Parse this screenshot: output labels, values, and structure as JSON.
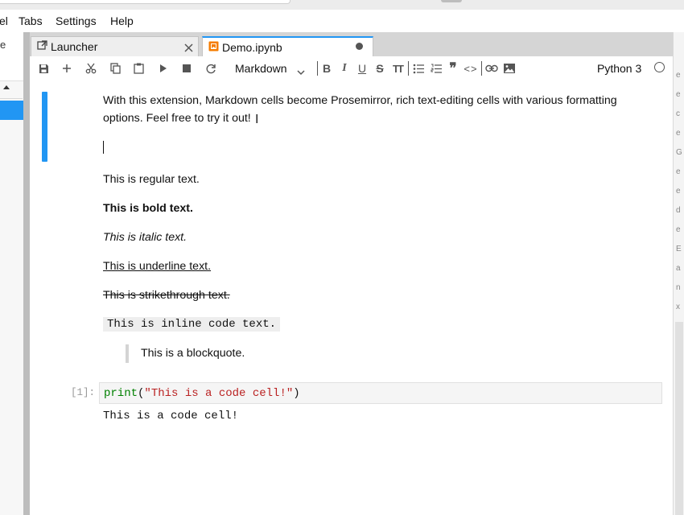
{
  "menubar": {
    "items": [
      "el",
      "Tabs",
      "Settings",
      "Help"
    ]
  },
  "sidebar": {
    "fragment": "e"
  },
  "tabs": [
    {
      "label": "Launcher",
      "icon": "launcher-icon",
      "action_icon": "close-icon"
    },
    {
      "label": "Demo.ipynb",
      "icon": "notebook-icon",
      "action_icon": "unsaved-dot-icon",
      "active": true
    }
  ],
  "toolbar": {
    "cell_type": "Markdown",
    "kernel_name": "Python 3",
    "format": {
      "bold": "B",
      "italic": "I",
      "underline": "U",
      "strike": "S",
      "text_size": "TT",
      "quote": "❞",
      "code": "<>"
    }
  },
  "notebook": {
    "intro_line1": "With this extension, Markdown cells become Prosemirror, rich text-editing cells with various formatting",
    "intro_line2": "options. Feel free to try it out!",
    "regular": "This is regular text.",
    "bold": "This is bold text.",
    "italic": "This is italic text.",
    "underline": "This is underline text.",
    "strikethrough": "This is strikethrough text.",
    "inline_code": "This is inline code text.",
    "blockquote": "This is a blockquote.",
    "code_cell": {
      "prompt": "[1]:",
      "fn": "print",
      "open": "(",
      "string": "\"This is a code cell!\"",
      "close": ")",
      "output": "This is a code cell!"
    }
  },
  "scroll_fragments": [
    "e",
    "e",
    "c",
    "e",
    "G",
    "e",
    "e",
    "d",
    "e",
    "E",
    "a",
    "n",
    "x"
  ],
  "colors": {
    "accent": "#2196f3",
    "code_fn": "#008000",
    "code_string": "#ba2121",
    "launcher_icon": "#444444",
    "notebook_icon": "#f57c00"
  }
}
